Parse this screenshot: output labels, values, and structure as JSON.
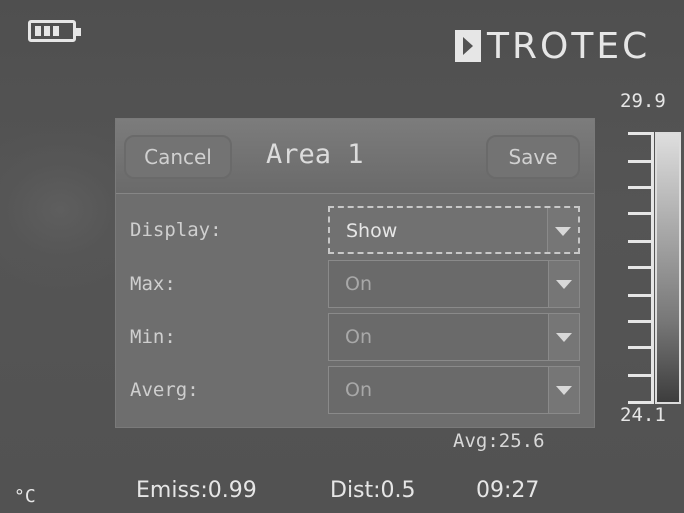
{
  "top_bar": {
    "battery_icon": "battery-full-icon",
    "logo_icon": "trotec-logo-icon",
    "brand": "TROTEC"
  },
  "scale": {
    "max": "29.9",
    "min": "24.1"
  },
  "dialog": {
    "title": "Area 1",
    "cancel_label": "Cancel",
    "save_label": "Save",
    "rows": [
      {
        "label": "Display:",
        "value": "Show"
      },
      {
        "label": "Max:",
        "value": "On"
      },
      {
        "label": "Min:",
        "value": "On"
      },
      {
        "label": "Averg:",
        "value": "On"
      }
    ]
  },
  "readout": {
    "avg": "Avg:25.6"
  },
  "status_bar": {
    "unit": "°C",
    "emissivity": "Emiss:0.99",
    "distance": "Dist:0.5",
    "time": "09:27"
  },
  "colors": {
    "background": "#525252",
    "dialog": "#6e6e6e",
    "text": "#e6e6e6"
  }
}
